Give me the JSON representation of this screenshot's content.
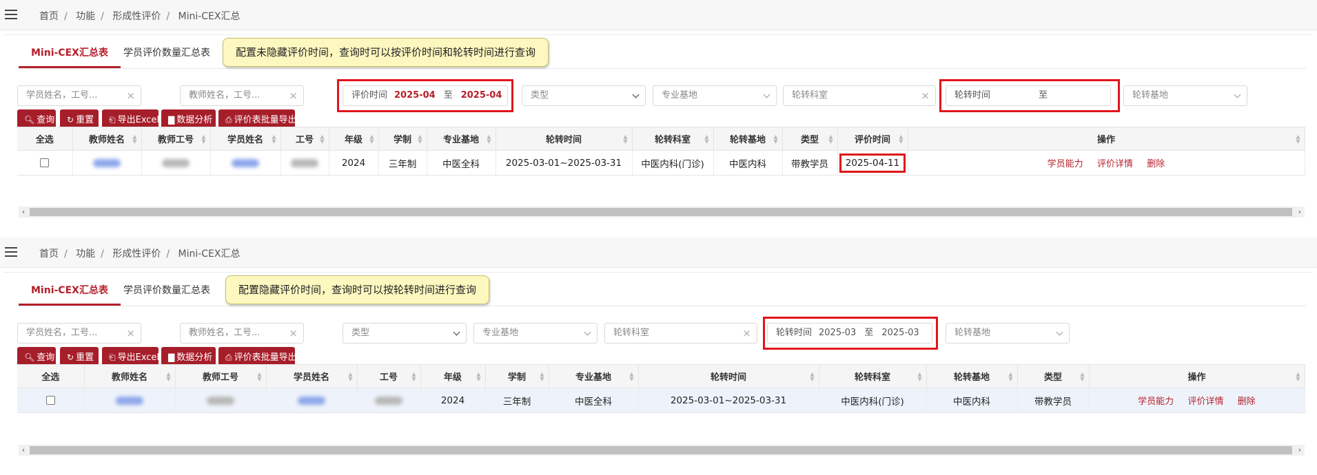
{
  "breadcrumb": [
    "首页",
    "功能",
    "形成性评价",
    "Mini-CEX汇总"
  ],
  "tabs": [
    "Mini-CEX汇总表",
    "学员评价数量汇总表"
  ],
  "top": {
    "note": "配置未隐藏评价时间，查询时可以按评价时间和轮转时间进行查询",
    "filters": {
      "student": "学员姓名，工号...",
      "teacher": "教师姓名，工号...",
      "eval_time_label": "评价时间",
      "eval_from": "2025-04",
      "eval_to": "2025-04",
      "type": "类型",
      "base": "专业基地",
      "dept": "轮转科室",
      "rot_time_label": "轮转时间",
      "rot_to_label": "至",
      "rot_base": "轮转基地",
      "to_word": "至"
    },
    "columns": [
      "全选",
      "教师姓名",
      "教师工号",
      "学员姓名",
      "工号",
      "年级",
      "学制",
      "专业基地",
      "轮转时间",
      "轮转科室",
      "轮转基地",
      "类型",
      "评价时间",
      "操作"
    ],
    "row": {
      "grade": "2024",
      "system": "三年制",
      "base": "中医全科",
      "rot_time": "2025-03-01~2025-03-31",
      "dept": "中医内科(门诊)",
      "rot_base": "中医内科",
      "type": "带教学员",
      "eval_time": "2025-04-11"
    }
  },
  "bottom": {
    "note": "配置隐藏评价时间，查询时可以按轮转时间进行查询",
    "filters": {
      "student": "学员姓名，工号...",
      "teacher": "教师姓名，工号...",
      "type": "类型",
      "base": "专业基地",
      "dept": "轮转科室",
      "rot_time_label": "轮转时间",
      "rot_from": "2025-03",
      "rot_to": "2025-03",
      "rot_base": "轮转基地",
      "to_word": "至"
    },
    "columns": [
      "全选",
      "教师姓名",
      "教师工号",
      "学员姓名",
      "工号",
      "年级",
      "学制",
      "专业基地",
      "轮转时间",
      "轮转科室",
      "轮转基地",
      "类型",
      "操作"
    ],
    "row": {
      "grade": "2024",
      "system": "三年制",
      "base": "中医全科",
      "rot_time": "2025-03-01~2025-03-31",
      "dept": "中医内科(门诊)",
      "rot_base": "中医内科",
      "type": "带教学员"
    }
  },
  "buttons": {
    "query": "查询",
    "reset": "重置",
    "export_excel": "导出Excel",
    "analysis": "数据分析",
    "batch_export": "评价表批量导出"
  },
  "actions": {
    "ability": "学员能力",
    "detail": "评价详情",
    "delete": "删除"
  },
  "colors": {
    "primary": "#a61e2a",
    "highlight": "#e0141b",
    "note_bg": "#fdf8c0"
  }
}
